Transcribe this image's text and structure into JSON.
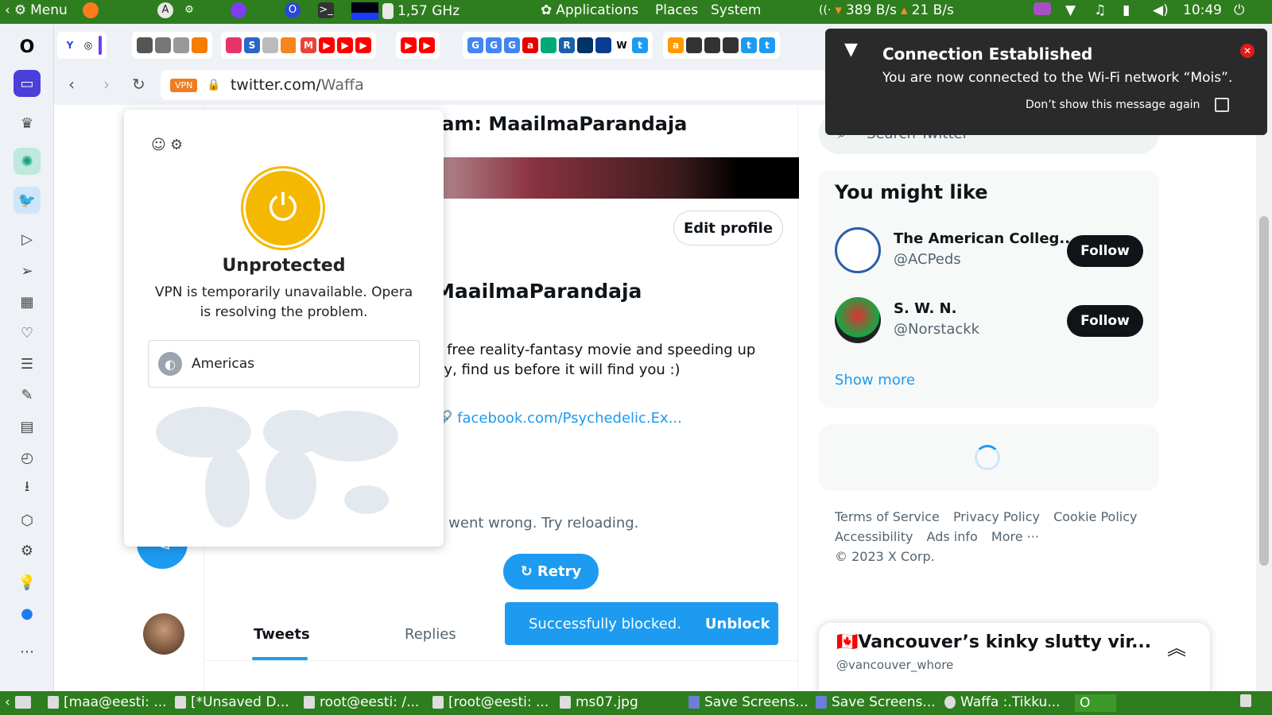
{
  "system_top": {
    "menu_label": "Menu",
    "cpu_freq": "1,57 GHz",
    "applications": "Applications",
    "places": "Places",
    "system": "System",
    "net_down": "389 B/s",
    "net_up": "21 B/s",
    "clock": "10:49"
  },
  "browser": {
    "vpn_badge": "VPN",
    "url_host": "twitter.com/",
    "url_path": "Waffa"
  },
  "profile": {
    "header_name": "lam: MaailmaParandaja",
    "edit_profile": "Edit profile",
    "display_name": "MaailmaParandaja",
    "bio_line1": "s free reality-fantasy movie and speeding up",
    "bio_line2": "dy, find us before it will find you :)",
    "link": "facebook.com/Psychedelic.Ex...",
    "error_text": "g went wrong. Try reloading.",
    "retry": "Retry",
    "tab_tweets": "Tweets",
    "tab_replies": "Replies"
  },
  "toast": {
    "message": "Successfully blocked.",
    "action": "Unblock"
  },
  "sidebar_right": {
    "search_placeholder": "Search Twitter",
    "you_might_like": "You might like",
    "suggestions": [
      {
        "name": "The American Colleg...",
        "handle": "@ACPeds",
        "follow": "Follow"
      },
      {
        "name": "S. W. N.",
        "handle": "@Norstackk",
        "follow": "Follow"
      }
    ],
    "show_more": "Show more",
    "footer": {
      "terms": "Terms of Service",
      "privacy": "Privacy Policy",
      "cookie": "Cookie Policy",
      "accessibility": "Accessibility",
      "ads": "Ads info",
      "more": "More ···",
      "copyright": "© 2023 X Corp."
    },
    "messages_drawer": {
      "title": "🇨🇦Vancouver’s kinky slutty vir...",
      "handle": "@vancouver_whore"
    }
  },
  "vpn_popup": {
    "status": "Unprotected",
    "description": "VPN is temporarily unavailable. Opera is resolving the problem.",
    "region": "Americas"
  },
  "notification": {
    "title": "Connection Established",
    "body": "You are now connected to the Wi-Fi network “Mois”.",
    "dont_show": "Don’t show this message again"
  },
  "taskbar": [
    {
      "label": "[maa@eesti: ..."
    },
    {
      "label": "[*Unsaved D..."
    },
    {
      "label": "root@eesti: /..."
    },
    {
      "label": "[root@eesti: ..."
    },
    {
      "label": "ms07.jpg"
    },
    {
      "label": "Save Screens..."
    },
    {
      "label": "Save Screens..."
    },
    {
      "label": "Waffa :.Tikku..."
    }
  ]
}
